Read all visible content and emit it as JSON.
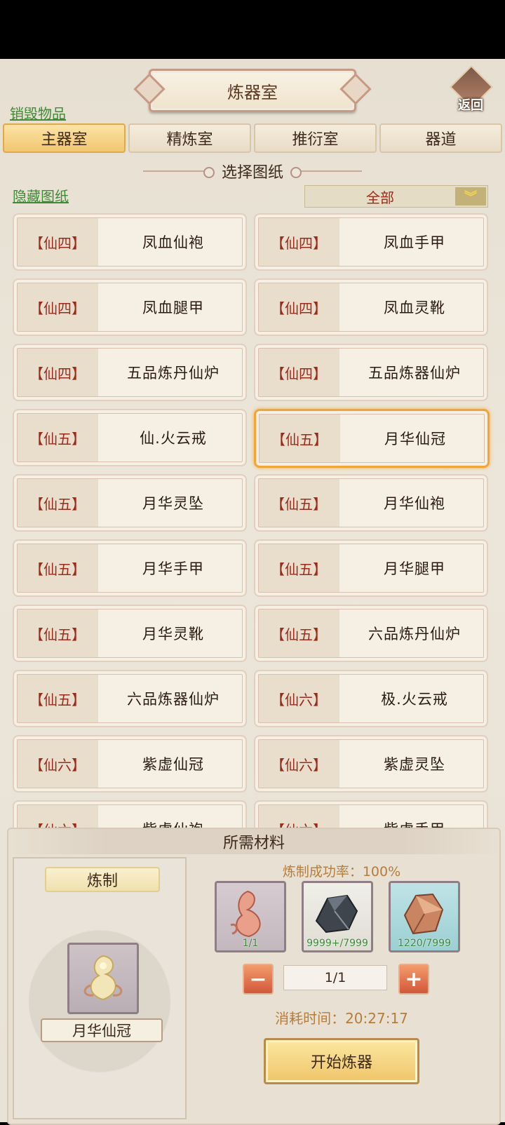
{
  "header": {
    "title": "炼器室",
    "back_label": "返回"
  },
  "links": {
    "destroy_items": "销毁物品",
    "hide_blueprints": "隐藏图纸"
  },
  "tabs": [
    {
      "label": "主器室",
      "active": true
    },
    {
      "label": "精炼室",
      "active": false
    },
    {
      "label": "推衍室",
      "active": false
    },
    {
      "label": "器道",
      "active": false
    }
  ],
  "section": {
    "title": "选择图纸"
  },
  "filter": {
    "value": "全部"
  },
  "blueprints": [
    {
      "tier": "【仙四】",
      "name": "凤血仙袍"
    },
    {
      "tier": "【仙四】",
      "name": "凤血手甲"
    },
    {
      "tier": "【仙四】",
      "name": "凤血腿甲"
    },
    {
      "tier": "【仙四】",
      "name": "凤血灵靴"
    },
    {
      "tier": "【仙四】",
      "name": "五品炼丹仙炉"
    },
    {
      "tier": "【仙四】",
      "name": "五品炼器仙炉"
    },
    {
      "tier": "【仙五】",
      "name": "仙.火云戒"
    },
    {
      "tier": "【仙五】",
      "name": "月华仙冠",
      "selected": true
    },
    {
      "tier": "【仙五】",
      "name": "月华灵坠"
    },
    {
      "tier": "【仙五】",
      "name": "月华仙袍"
    },
    {
      "tier": "【仙五】",
      "name": "月华手甲"
    },
    {
      "tier": "【仙五】",
      "name": "月华腿甲"
    },
    {
      "tier": "【仙五】",
      "name": "月华灵靴"
    },
    {
      "tier": "【仙五】",
      "name": "六品炼丹仙炉"
    },
    {
      "tier": "【仙五】",
      "name": "六品炼器仙炉"
    },
    {
      "tier": "【仙六】",
      "name": "极.火云戒"
    },
    {
      "tier": "【仙六】",
      "name": "紫虚仙冠"
    },
    {
      "tier": "【仙六】",
      "name": "紫虚灵坠"
    },
    {
      "tier": "【仙六】",
      "name": "紫虚仙袍"
    },
    {
      "tier": "【仙六】",
      "name": "紫虚手甲"
    }
  ],
  "materials_panel": {
    "title": "所需材料",
    "craft_label": "炼制",
    "craft_item_name": "月华仙冠",
    "success_rate": "炼制成功率：100%",
    "materials": [
      {
        "icon": "phoenix-feather-icon",
        "count": "1/1"
      },
      {
        "icon": "dark-ore-icon",
        "count": "9999+/7999"
      },
      {
        "icon": "copper-ore-icon",
        "count": "1220/7999"
      }
    ],
    "quantity": "1/1",
    "minus": "−",
    "plus": "+",
    "time": "消耗时间：20:27:17",
    "start_label": "开始炼器"
  }
}
